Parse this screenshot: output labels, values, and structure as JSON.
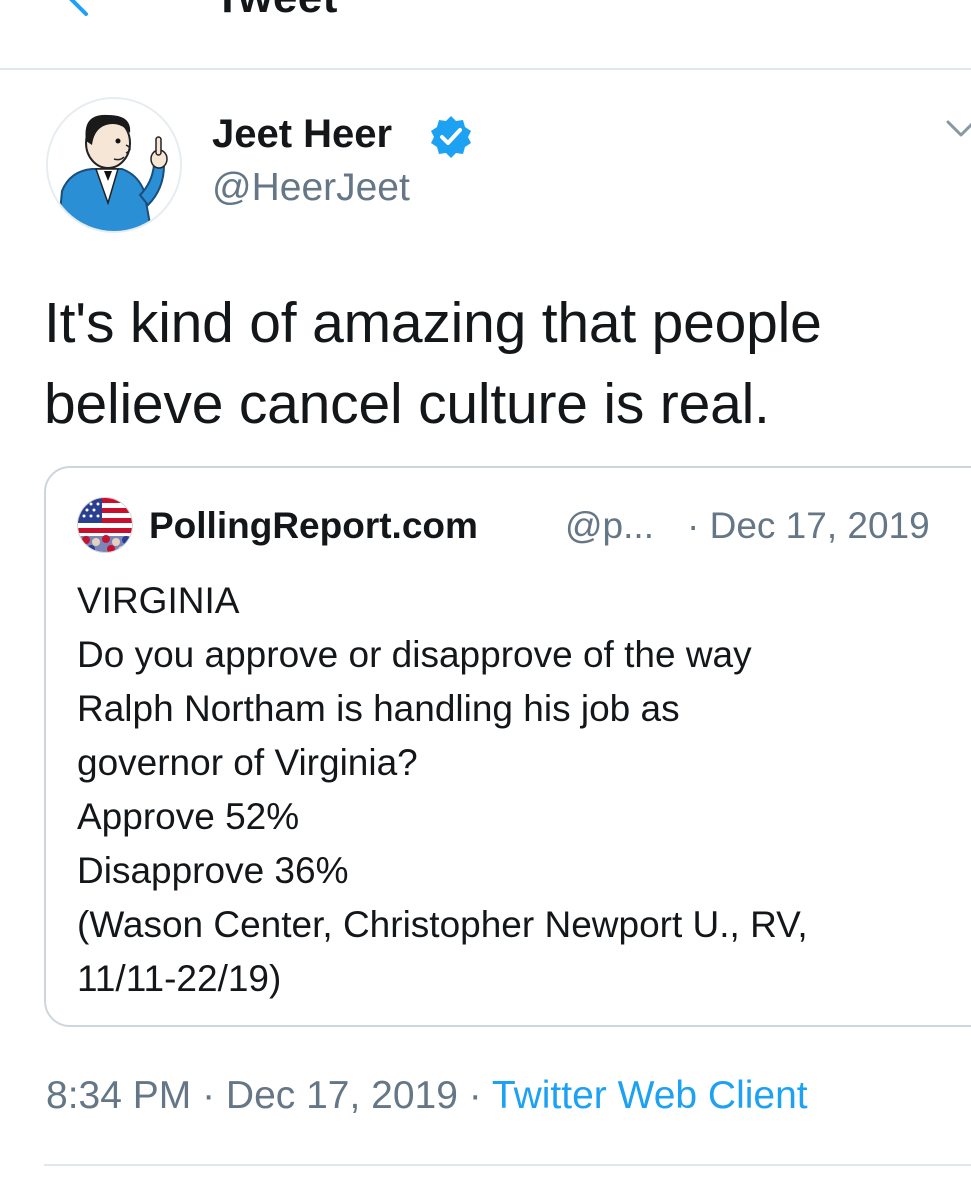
{
  "nav": {
    "title": "Tweet",
    "back_icon": "back-arrow-icon"
  },
  "author": {
    "name": "Jeet Heer",
    "handle": "@HeerJeet",
    "verified": true
  },
  "tweet": {
    "text": "It's kind of amazing that people believe cancel culture is real."
  },
  "quote": {
    "name": "PollingReport.com",
    "handle": "@p...",
    "date": "· Dec 17, 2019",
    "lines": [
      "VIRGINIA",
      "Do you approve or disapprove of the way",
      "Ralph Northam is handling his job as",
      "governor of Virginia?",
      "Approve 52%",
      "Disapprove 36%",
      "(Wason Center, Christopher Newport U., RV,",
      "11/11-22/19)"
    ]
  },
  "meta": {
    "time": "8:34 PM",
    "separator1": " · ",
    "date": "Dec 17, 2019",
    "separator2": " · ",
    "source": "Twitter Web Client"
  },
  "colors": {
    "link": "#1da1f2",
    "secondary_text": "#657786",
    "border": "#ccd6dd"
  }
}
